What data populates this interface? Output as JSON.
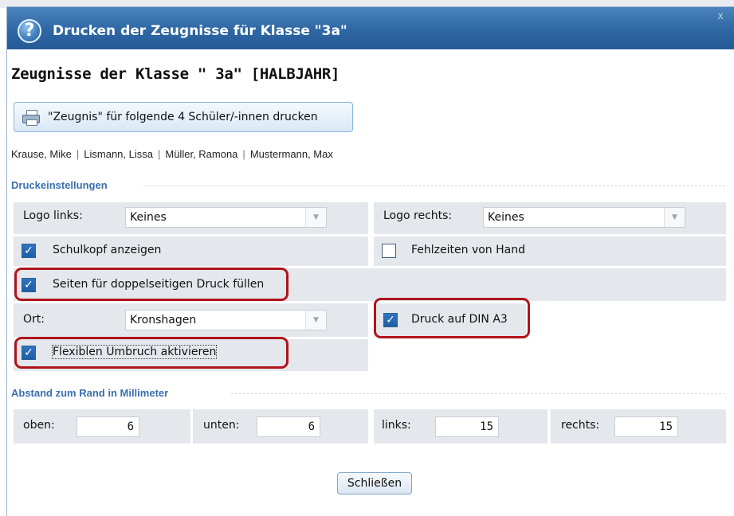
{
  "dialog": {
    "title": "Drucken der Zeugnisse für Klasse \"3a\"",
    "help_icon": "?",
    "close_icon": "x"
  },
  "heading": "Zeugnisse der Klasse \" 3a\" [HALBJAHR]",
  "print_button": {
    "icon": "printer-icon",
    "label": "\"Zeugnis\" für folgende 4  Schüler/-innen drucken"
  },
  "students": [
    "Krause, Mike",
    "Lismann, Lissa",
    "Müller, Ramona",
    "Mustermann, Max"
  ],
  "student_separator": "|",
  "print_settings": {
    "label": "Druckeinstellungen",
    "logo_left": {
      "label": "Logo links:",
      "value": "Keines"
    },
    "logo_right": {
      "label": "Logo rechts:",
      "value": "Keines"
    },
    "school_header": {
      "label": "Schulkopf anzeigen",
      "checked": true
    },
    "absence_manual": {
      "label": "Fehlzeiten von Hand",
      "checked": false
    },
    "fill_duplex": {
      "label": "Seiten für doppelseitigen Druck füllen",
      "checked": true
    },
    "place": {
      "label": "Ort:",
      "value": "Kronshagen"
    },
    "din_a3": {
      "label": "Druck auf DIN A3",
      "checked": true
    },
    "flex_break": {
      "label": "Flexiblen Umbruch aktivieren",
      "checked": true
    }
  },
  "margins": {
    "label": "Abstand zum Rand in Millimeter",
    "top": {
      "label": "oben:",
      "value": "6"
    },
    "bottom": {
      "label": "unten:",
      "value": "6"
    },
    "left": {
      "label": "links:",
      "value": "15"
    },
    "right": {
      "label": "rechts:",
      "value": "15"
    }
  },
  "close_button": "Schließen",
  "colors": {
    "title_bar": "#2f67a4",
    "section_label": "#3a6fb0",
    "highlight": "#b0141a",
    "panel": "#e4e7ec"
  }
}
